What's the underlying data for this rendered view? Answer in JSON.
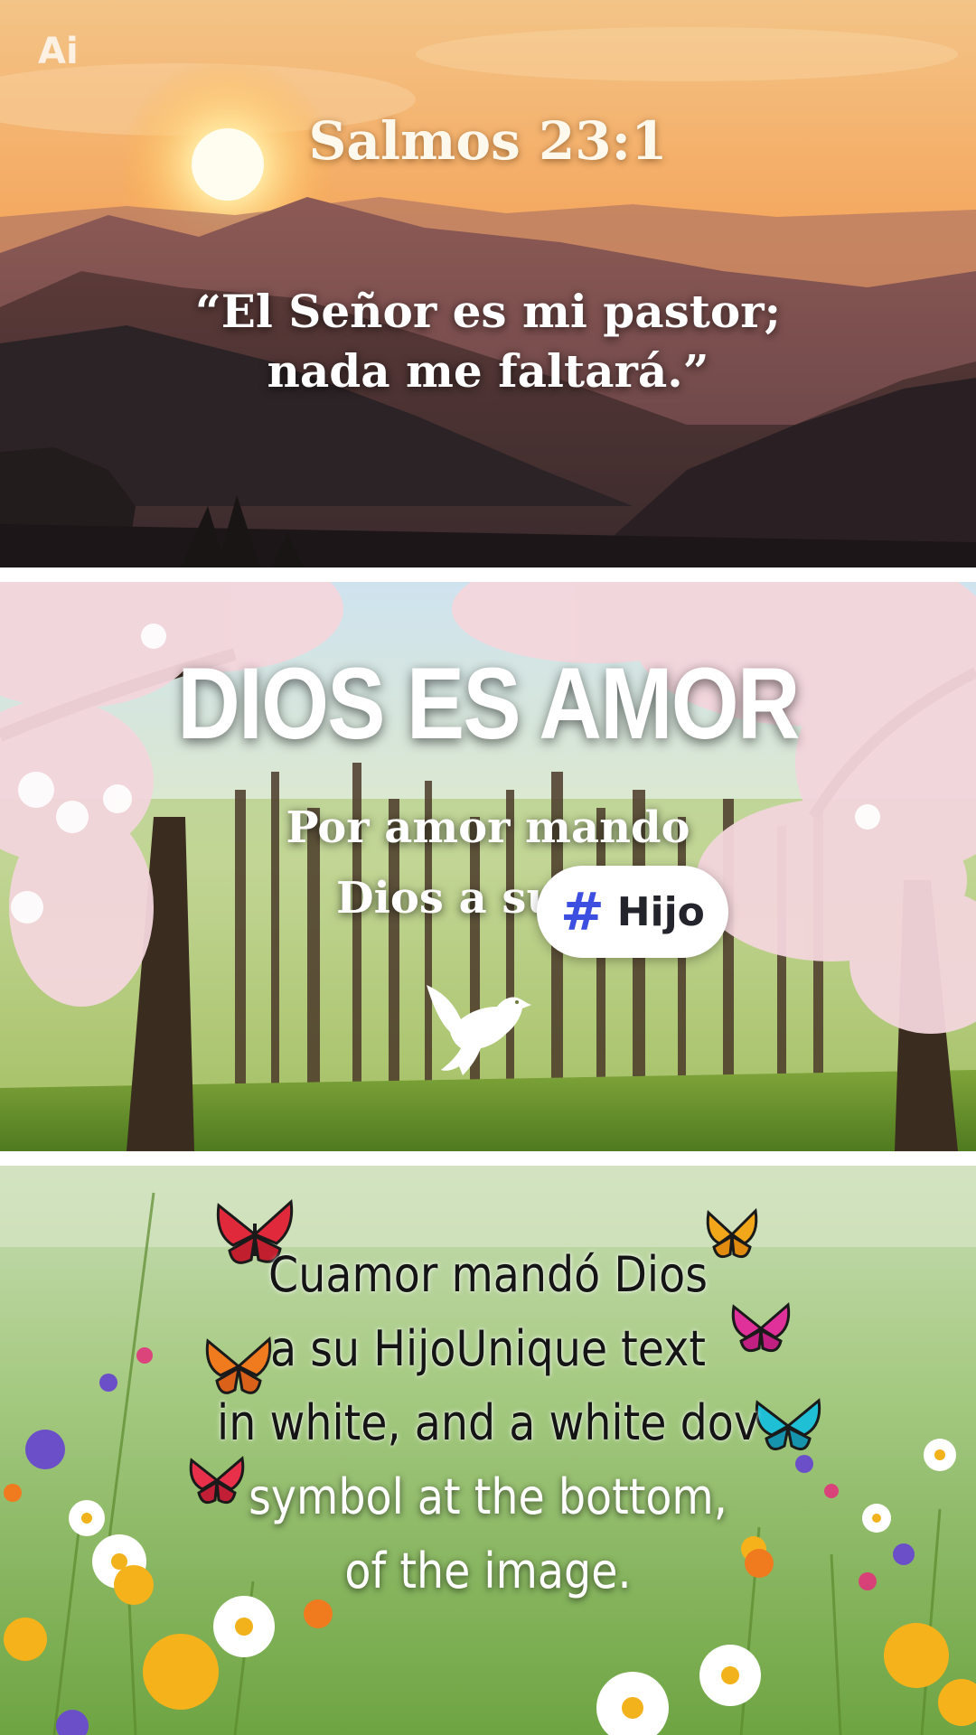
{
  "badge": {
    "label": "Ai"
  },
  "panel1": {
    "reference": "Salmos 23:1",
    "verse_lines": [
      "“El Señor es mi pastor;",
      "nada me faltará.”"
    ]
  },
  "panel2": {
    "headline": "DIOS ES AMOR",
    "line1": "Por amor mando",
    "line2": "Dios a su",
    "hashtag_symbol": "#",
    "hashtag_word": "Hijo",
    "hashtag_color": "#3d4fe0",
    "symbol": "dove-icon"
  },
  "panel3": {
    "lines": [
      "Cuamor mandó Dios",
      "a su HijoUnique text",
      "in white, and a white dov",
      "symbol at the bottom,",
      "of the image."
    ]
  }
}
